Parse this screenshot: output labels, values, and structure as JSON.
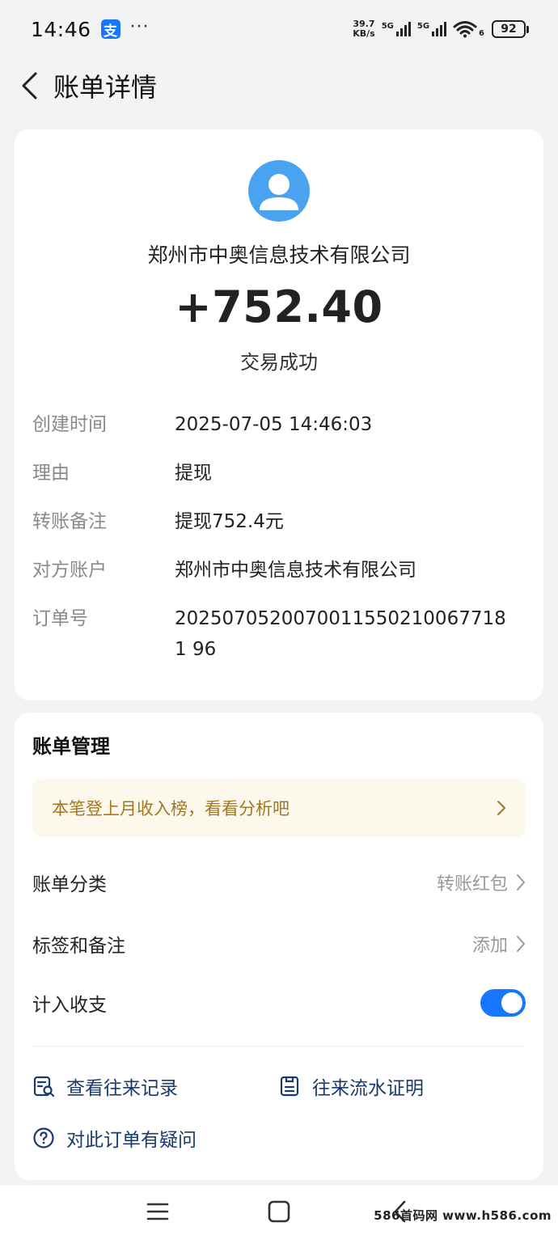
{
  "status_bar": {
    "time": "14:46",
    "app_badge": "支",
    "more": "···",
    "net_speed_value": "39.7",
    "net_speed_unit": "KB/s",
    "sim1_label": "5G",
    "sim2_label": "5G",
    "wifi_label": "6",
    "battery": "92"
  },
  "nav": {
    "title": "账单详情"
  },
  "summary": {
    "counterparty": "郑州市中奥信息技术有限公司",
    "amount": "+752.40",
    "status": "交易成功",
    "avatar_color": "#4aa3f0"
  },
  "details": [
    {
      "label": "创建时间",
      "value": "2025-07-05 14:46:03"
    },
    {
      "label": "理由",
      "value": "提现"
    },
    {
      "label": "转账备注",
      "value": "提现752.4元"
    },
    {
      "label": "对方账户",
      "value": "郑州市中奥信息技术有限公司"
    },
    {
      "label": "订单号",
      "value": "20250705200700115502100677181 96"
    }
  ],
  "management": {
    "title": "账单管理",
    "promo": "本笔登上月收入榜，看看分析吧",
    "category_label": "账单分类",
    "category_value": "转账红包",
    "tags_label": "标签和备注",
    "tags_value": "添加",
    "include_label": "计入收支",
    "include_enabled": true
  },
  "actions": {
    "records": "查看往来记录",
    "proof": "往来流水证明",
    "question": "对此订单有疑问"
  },
  "watermark": "586首码网 www.h586.com",
  "colors": {
    "accent": "#1677ff",
    "promo_text": "#a3771f",
    "promo_bg": "#fcf8ec",
    "link_text": "#1a3a6b"
  }
}
